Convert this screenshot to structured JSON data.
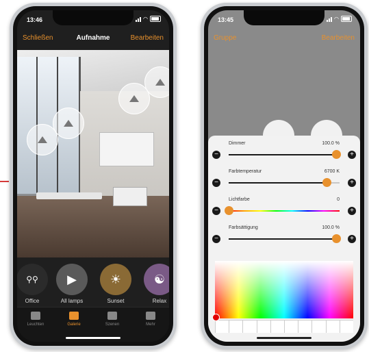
{
  "left": {
    "time": "13:46",
    "nav": {
      "left": "Schließen",
      "title": "Aufnahme",
      "right": "Bearbeiten"
    },
    "scenes": [
      {
        "label": "Office",
        "icon": "bulbs-icon",
        "color": "#2b2b2b"
      },
      {
        "label": "All lamps",
        "icon": "scene-play-icon",
        "color": "#5a5a5a"
      },
      {
        "label": "Sunset",
        "icon": "sun-icon",
        "color": "#8a6a35"
      },
      {
        "label": "Relax",
        "icon": "yin-yang-icon",
        "color": "#7a5a86"
      }
    ],
    "tabs": [
      {
        "label": "Leuchten",
        "active": false
      },
      {
        "label": "Galerie",
        "active": true
      },
      {
        "label": "Szenen",
        "active": false
      },
      {
        "label": "Mehr",
        "active": false
      }
    ]
  },
  "right": {
    "time": "13:45",
    "nav": {
      "left": "Gruppe",
      "right": "Bearbeiten"
    },
    "sliders": [
      {
        "label": "Dimmer",
        "value": "100.0 %",
        "level": 0.97
      },
      {
        "label": "Farbtemperatur",
        "value": "6700 K",
        "level": 0.88
      },
      {
        "label": "Lichtfarbe",
        "value": "0",
        "level": 0.0
      },
      {
        "label": "Farbsättigung",
        "value": "100.0 %",
        "level": 0.97
      }
    ],
    "swatch_count": 10
  },
  "accent": "#e8912d"
}
